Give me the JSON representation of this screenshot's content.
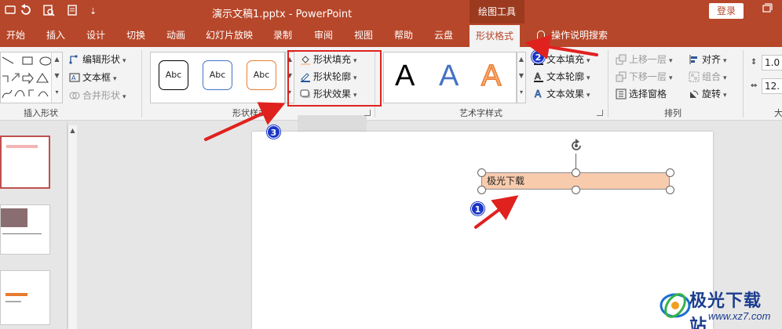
{
  "titlebar": {
    "app_title": "演示文稿1.pptx  -  PowerPoint",
    "context_group": "绘图工具",
    "login_label": "登录",
    "restore_icon": "restore-window-icon",
    "quick_access": [
      "autosave-icon",
      "undo-icon",
      "print-preview-icon",
      "customize-qat-icon"
    ],
    "bg_color": "#b7472a"
  },
  "tabs": [
    {
      "label": "开始"
    },
    {
      "label": "插入"
    },
    {
      "label": "设计"
    },
    {
      "label": "切换"
    },
    {
      "label": "动画"
    },
    {
      "label": "幻灯片放映"
    },
    {
      "label": "录制"
    },
    {
      "label": "审阅"
    },
    {
      "label": "视图"
    },
    {
      "label": "帮助"
    },
    {
      "label": "云盘"
    },
    {
      "label": "形状格式",
      "active": true
    }
  ],
  "tell_me": "操作说明搜索",
  "ribbon": {
    "insert_shapes": {
      "label": "插入形状",
      "edit_shape": "编辑形状",
      "text_box": "文本框",
      "merge_shapes": "合并形状"
    },
    "shape_styles": {
      "label": "形状样式",
      "presets": [
        "Abc",
        "Abc",
        "Abc"
      ],
      "preset_colors": [
        "#000000",
        "#4472c4",
        "#ed7d31"
      ],
      "fill": "形状填充",
      "outline": "形状轮廓",
      "effects": "形状效果"
    },
    "wordart": {
      "label": "艺术字样式",
      "letters": [
        "A",
        "A",
        "A"
      ],
      "text_fill": "文本填充",
      "text_outline": "文本轮廓",
      "text_effects": "文本效果"
    },
    "arrange": {
      "label": "排列",
      "bring_forward": "上移一层",
      "send_backward": "下移一层",
      "selection_pane": "选择窗格",
      "align": "对齐",
      "group": "组合",
      "rotate": "旋转"
    },
    "size": {
      "label": "大",
      "height": "1.0",
      "width": "12."
    }
  },
  "slide": {
    "textbox_text": "极光下载",
    "textbox_fill": "#f8cbad"
  },
  "badges": [
    "1",
    "2",
    "3"
  ],
  "watermark": {
    "text": "极光下载站",
    "url": "www.xz7.com"
  }
}
